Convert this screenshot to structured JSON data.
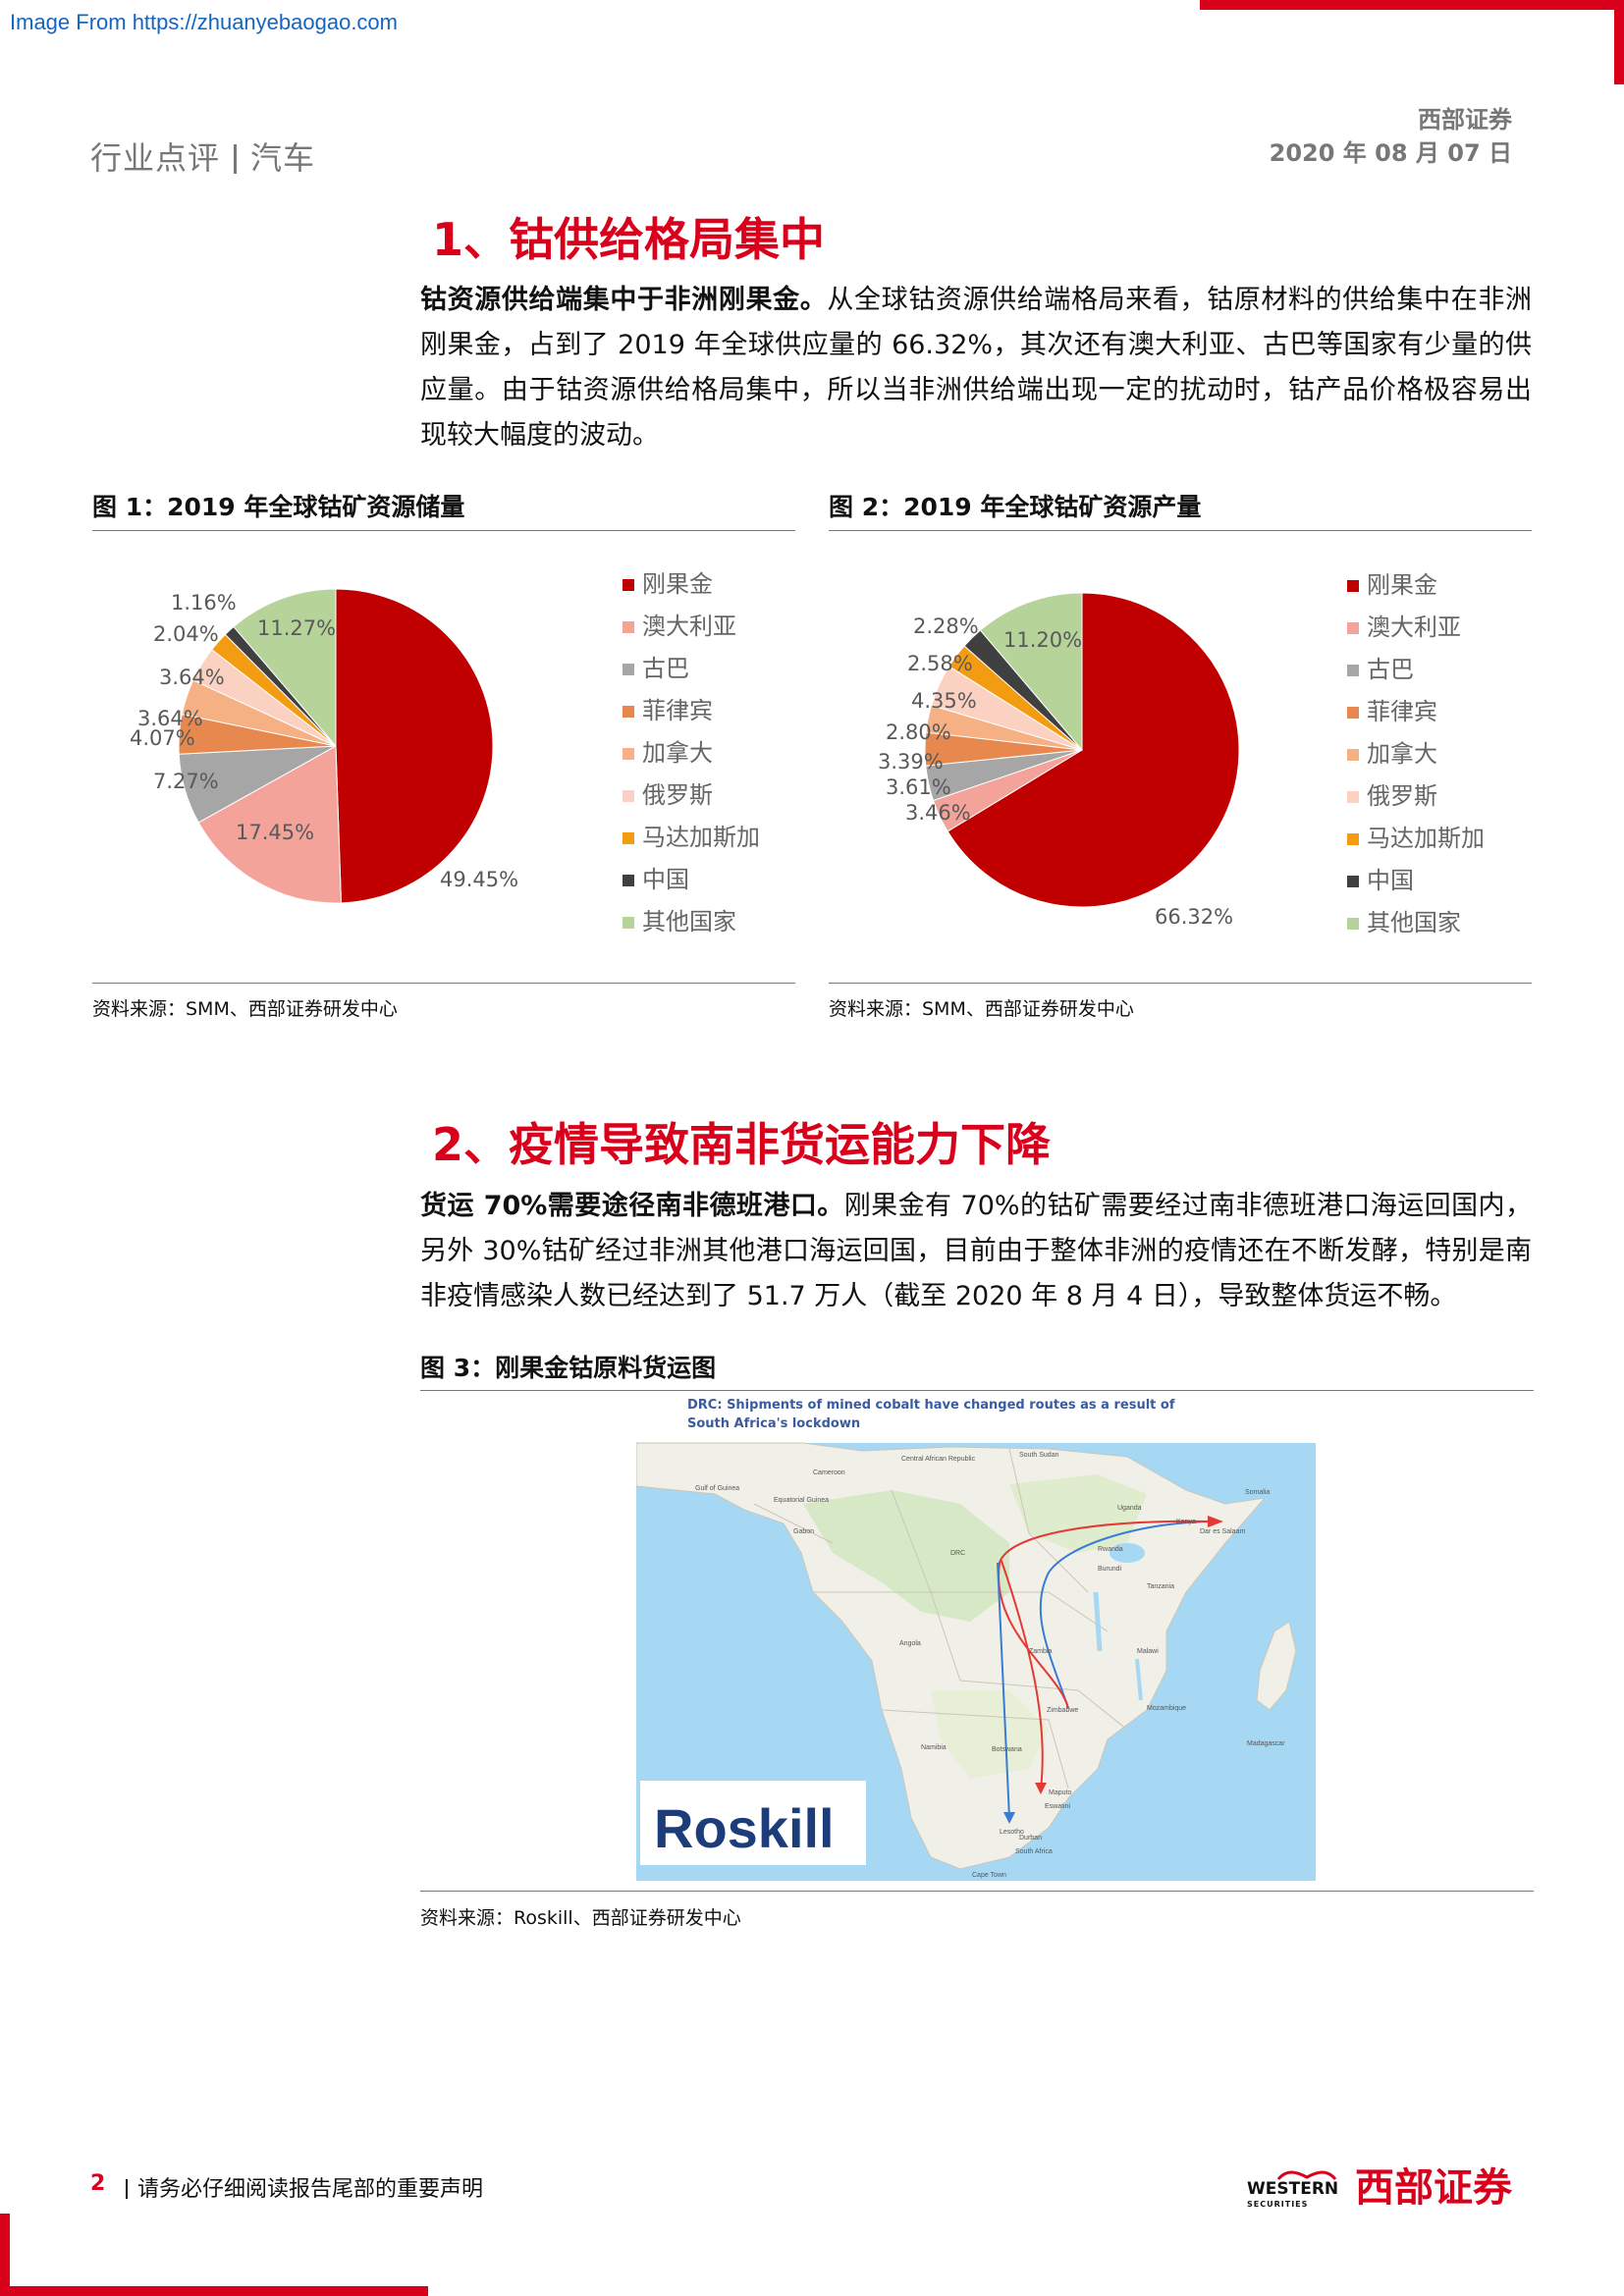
{
  "watermark": "Image From https://zhuanyebaogao.com",
  "header": {
    "category": "行业点评",
    "industry": "汽车",
    "company": "西部证券",
    "date": "2020 年 08 月 07 日"
  },
  "section1": {
    "title": "1、钴供给格局集中",
    "lead": "钴资源供给端集中于非洲刚果金。",
    "body": "从全球钴资源供给端格局来看，钴原材料的供给集中在非洲刚果金，占到了 2019 年全球供应量的 66.32%，其次还有澳大利亚、古巴等国家有少量的供应量。由于钴资源供给格局集中，所以当非洲供给端出现一定的扰动时，钴产品价格极容易出现较大幅度的波动。"
  },
  "figure1": {
    "title": "图 1：2019 年全球钴矿资源储量",
    "source": "资料来源：SMM、西部证券研发中心"
  },
  "figure2": {
    "title": "图 2：2019 年全球钴矿资源产量",
    "source": "资料来源：SMM、西部证券研发中心"
  },
  "chart_data": [
    {
      "type": "pie",
      "title": "图 1：2019 年全球钴矿资源储量",
      "categories": [
        "刚果金",
        "澳大利亚",
        "古巴",
        "菲律宾",
        "加拿大",
        "俄罗斯",
        "马达加斯加",
        "中国",
        "其他国家"
      ],
      "values": [
        49.45,
        17.45,
        7.27,
        4.07,
        3.64,
        3.64,
        2.04,
        1.16,
        11.27
      ],
      "labels": [
        "49.45%",
        "17.45%",
        "7.27%",
        "4.07%",
        "3.64%",
        "3.64%",
        "2.04%",
        "1.16%",
        "11.27%"
      ],
      "colors": [
        "#c00000",
        "#f4a39b",
        "#a6a6a6",
        "#e7894e",
        "#f5b183",
        "#fbd2c2",
        "#f39c12",
        "#404040",
        "#b6d39a"
      ],
      "legend": "right"
    },
    {
      "type": "pie",
      "title": "图 2：2019 年全球钴矿资源产量",
      "categories": [
        "刚果金",
        "澳大利亚",
        "古巴",
        "菲律宾",
        "加拿大",
        "俄罗斯",
        "马达加斯加",
        "中国",
        "其他国家"
      ],
      "values": [
        66.32,
        3.46,
        3.61,
        3.39,
        2.8,
        4.35,
        2.58,
        2.28,
        11.2
      ],
      "labels": [
        "66.32%",
        "3.46%",
        "3.61%",
        "3.39%",
        "2.80%",
        "4.35%",
        "2.58%",
        "2.28%",
        "11.20%"
      ],
      "colors": [
        "#c00000",
        "#f4a39b",
        "#a6a6a6",
        "#e7894e",
        "#f5b183",
        "#fbd2c2",
        "#f39c12",
        "#404040",
        "#b6d39a"
      ],
      "legend": "right"
    }
  ],
  "section2": {
    "title": "2、疫情导致南非货运能力下降",
    "lead": "货运 70%需要途径南非德班港口。",
    "body": "刚果金有 70%的钴矿需要经过南非德班港口海运回国内，另外 30%钴矿经过非洲其他港口海运回国，目前由于整体非洲的疫情还在不断发酵，特别是南非疫情感染人数已经达到了 51.7 万人（截至 2020 年 8 月 4 日），导致整体货运不畅。"
  },
  "figure3": {
    "title": "图 3：刚果金钴原料货运图",
    "source": "资料来源：Roskill、西部证券研发中心",
    "map_caption": "DRC: Shipments of mined cobalt have changed routes as a result of South Africa's lockdown",
    "brand": "Roskill",
    "places": [
      "Cameroon",
      "Central African Republic",
      "South Sudan",
      "Somalia",
      "Uganda",
      "Kenya",
      "Gabon",
      "Equatorial Guinea",
      "DRC",
      "Rwanda",
      "Burundi",
      "Tanzania",
      "Dar es Salaam",
      "Angola",
      "Zambia",
      "Malawi",
      "Mozambique",
      "Zimbabwe",
      "Madagascar",
      "Namibia",
      "Botswana",
      "Maputo",
      "Eswatini",
      "Lesotho",
      "Durban",
      "South Africa",
      "Cape Town",
      "Gulf of Guinea"
    ]
  },
  "footer": {
    "page": "2",
    "notice": "请务必仔细阅读报告尾部的重要声明",
    "logo_en": "WESTERN",
    "logo_en_sub": "SECURITIES",
    "logo_cn": "西部证券"
  }
}
